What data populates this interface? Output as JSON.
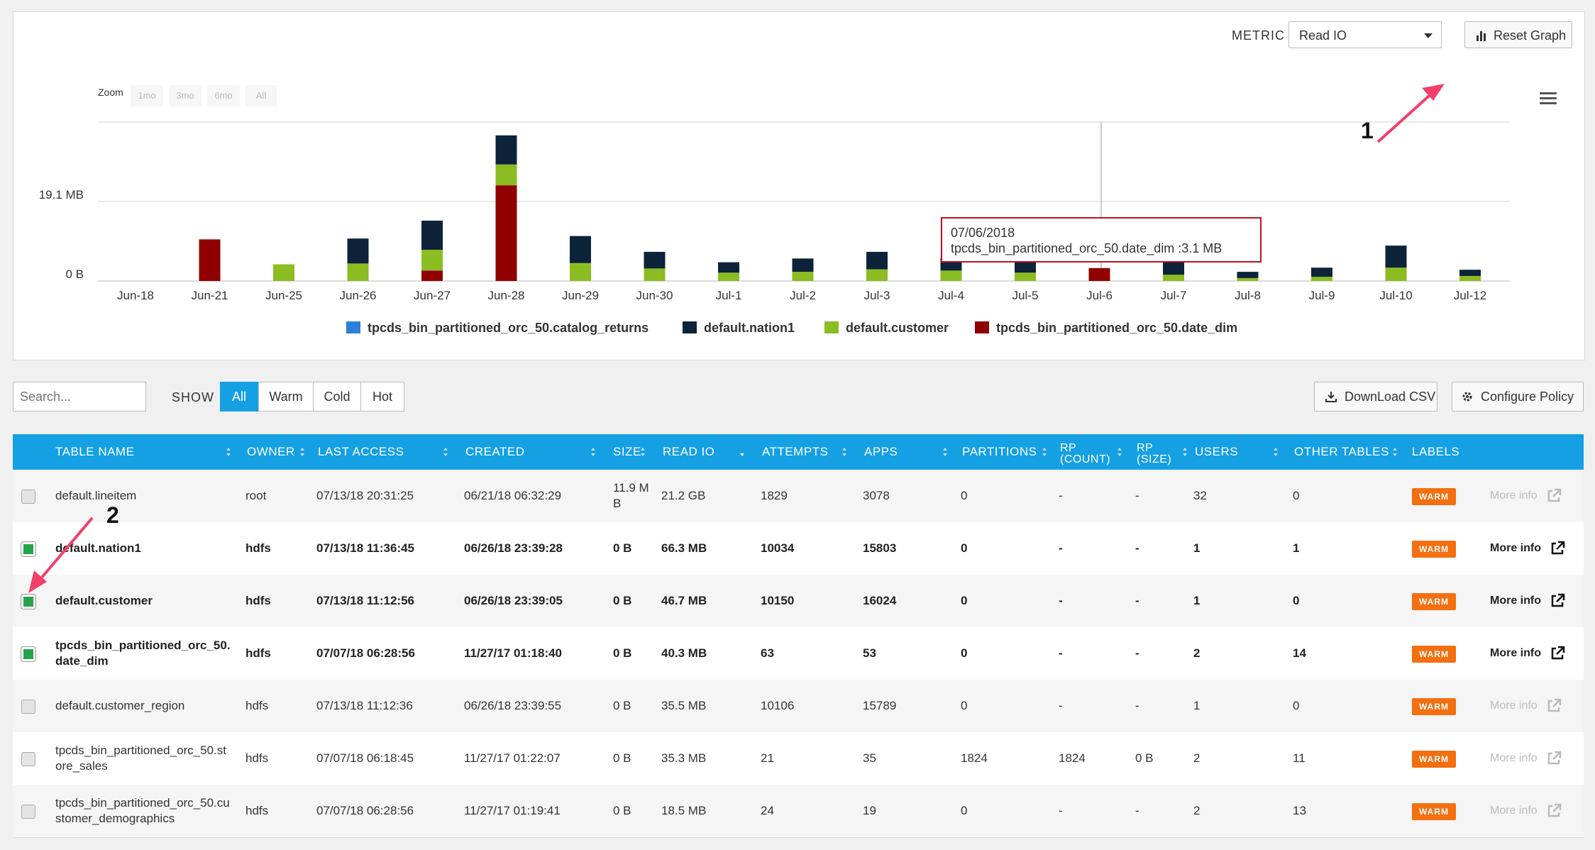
{
  "header": {
    "metric_label": "METRIC",
    "metric_value": "Read IO",
    "reset_label": "Reset Graph"
  },
  "zoom": {
    "label": "Zoom",
    "options": [
      "1mo",
      "3mo",
      "6mo",
      "All"
    ]
  },
  "chart_data": {
    "type": "bar",
    "stacked": true,
    "categories": [
      "Jun-18",
      "Jun-21",
      "Jun-25",
      "Jun-26",
      "Jun-27",
      "Jun-28",
      "Jun-29",
      "Jun-30",
      "Jul-1",
      "Jul-2",
      "Jul-3",
      "Jul-4",
      "Jul-5",
      "Jul-6",
      "Jul-7",
      "Jul-8",
      "Jul-9",
      "Jul-10",
      "Jul-12"
    ],
    "y_tick_labels": [
      "0 B",
      "19.1 MB"
    ],
    "ylabel": "",
    "ylim": [
      0,
      38.2
    ],
    "grid": true,
    "legend_position": "bottom",
    "series": [
      {
        "name": "tpcds_bin_partitioned_orc_50.catalog_returns",
        "color": "#2f7ed8",
        "values": [
          0,
          0,
          0,
          0,
          0,
          0,
          0,
          0,
          0,
          0,
          0,
          0,
          0,
          0,
          0,
          0,
          0,
          0,
          0
        ]
      },
      {
        "name": "default.nation1",
        "color": "#0d233a",
        "values": [
          0,
          0,
          0,
          6.0,
          7.0,
          7.0,
          6.5,
          4.0,
          2.5,
          3.2,
          4.2,
          3.0,
          2.5,
          0,
          3.3,
          1.5,
          2.2,
          5.3,
          1.5
        ]
      },
      {
        "name": "default.customer",
        "color": "#8bbc21",
        "values": [
          0,
          0,
          4.0,
          4.2,
          5.0,
          5.0,
          4.3,
          3.0,
          2.0,
          2.2,
          2.8,
          2.5,
          2.0,
          0,
          1.5,
          0.7,
          1.0,
          3.2,
          1.2
        ]
      },
      {
        "name": "tpcds_bin_partitioned_orc_50.date_dim",
        "color": "#910000",
        "values": [
          0,
          10.0,
          0,
          0,
          2.5,
          23.0,
          0,
          0,
          0,
          0,
          0,
          0,
          0,
          3.1,
          0,
          0,
          0,
          0,
          0
        ]
      }
    ],
    "tooltip": {
      "date": "07/06/2018",
      "series": "tpcds_bin_partitioned_orc_50.date_dim",
      "value": ":3.1 MB"
    }
  },
  "toolbar": {
    "search_placeholder": "Search...",
    "show_label": "SHOW",
    "filters": [
      "All",
      "Warm",
      "Cold",
      "Hot"
    ],
    "download_label": "DownLoad CSV",
    "configure_label": "Configure Policy"
  },
  "table": {
    "columns": [
      "TABLE NAME",
      "OWNER",
      "LAST ACCESS",
      "CREATED",
      "SIZE",
      "READ IO",
      "ATTEMPTS",
      "APPS",
      "PARTITIONS",
      "RP (COUNT)",
      "RP (SIZE)",
      "USERS",
      "OTHER TABLES",
      "LABELS"
    ],
    "rows": [
      {
        "name": "default.lineitem",
        "owner": "root",
        "last_access": "07/13/18 20:31:25",
        "created": "06/21/18 06:32:29",
        "size": "11.9 MB",
        "read_io": "21.2 GB",
        "attempts": "1829",
        "apps": "3078",
        "partitions": "0",
        "rp_count": "-",
        "rp_size": "-",
        "users": "32",
        "other_tables": "0",
        "label": "WARM",
        "more": "More info"
      },
      {
        "name": "default.nation1",
        "owner": "hdfs",
        "last_access": "07/13/18 11:36:45",
        "created": "06/26/18 23:39:28",
        "size": "0 B",
        "read_io": "66.3 MB",
        "attempts": "10034",
        "apps": "15803",
        "partitions": "0",
        "rp_count": "-",
        "rp_size": "-",
        "users": "1",
        "other_tables": "1",
        "label": "WARM",
        "more": "More info"
      },
      {
        "name": "default.customer",
        "owner": "hdfs",
        "last_access": "07/13/18 11:12:56",
        "created": "06/26/18 23:39:05",
        "size": "0 B",
        "read_io": "46.7 MB",
        "attempts": "10150",
        "apps": "16024",
        "partitions": "0",
        "rp_count": "-",
        "rp_size": "-",
        "users": "1",
        "other_tables": "0",
        "label": "WARM",
        "more": "More info"
      },
      {
        "name": "tpcds_bin_partitioned_orc_50.date_dim",
        "owner": "hdfs",
        "last_access": "07/07/18 06:28:56",
        "created": "11/27/17 01:18:40",
        "size": "0 B",
        "read_io": "40.3 MB",
        "attempts": "63",
        "apps": "53",
        "partitions": "0",
        "rp_count": "-",
        "rp_size": "-",
        "users": "2",
        "other_tables": "14",
        "label": "WARM",
        "more": "More info"
      },
      {
        "name": "default.customer_region",
        "owner": "hdfs",
        "last_access": "07/13/18 11:12:36",
        "created": "06/26/18 23:39:55",
        "size": "0 B",
        "read_io": "35.5 MB",
        "attempts": "10106",
        "apps": "15789",
        "partitions": "0",
        "rp_count": "-",
        "rp_size": "-",
        "users": "1",
        "other_tables": "0",
        "label": "WARM",
        "more": "More info"
      },
      {
        "name": "tpcds_bin_partitioned_orc_50.store_sales",
        "owner": "hdfs",
        "last_access": "07/07/18 06:18:45",
        "created": "11/27/17 01:22:07",
        "size": "0 B",
        "read_io": "35.3 MB",
        "attempts": "21",
        "apps": "35",
        "partitions": "1824",
        "rp_count": "1824",
        "rp_size": "0 B",
        "users": "2",
        "other_tables": "11",
        "label": "WARM",
        "more": "More info"
      },
      {
        "name": "tpcds_bin_partitioned_orc_50.customer_demographics",
        "owner": "hdfs",
        "last_access": "07/07/18 06:28:56",
        "created": "11/27/17 01:19:41",
        "size": "0 B",
        "read_io": "18.5 MB",
        "attempts": "24",
        "apps": "19",
        "partitions": "0",
        "rp_count": "-",
        "rp_size": "-",
        "users": "2",
        "other_tables": "13",
        "label": "WARM",
        "more": "More info"
      }
    ]
  },
  "annotations": {
    "one": "1",
    "two": "2"
  }
}
